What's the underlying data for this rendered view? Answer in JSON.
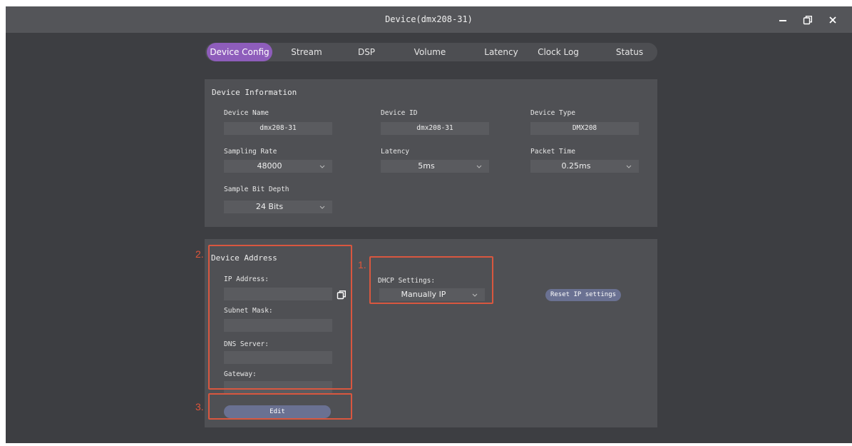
{
  "window": {
    "title": "Device(dmx208-31)",
    "controls": {
      "minimize_icon": "minimize-icon",
      "maximize_icon": "restore-icon",
      "close_icon": "close-icon"
    }
  },
  "tabs": [
    {
      "label": "Device Config",
      "active": true
    },
    {
      "label": "Stream",
      "active": false
    },
    {
      "label": "DSP",
      "active": false
    },
    {
      "label": "Volume",
      "active": false
    },
    {
      "label": "Latency",
      "active": false
    },
    {
      "label": "Clock Log",
      "active": false
    },
    {
      "label": "Status",
      "active": false
    }
  ],
  "device_info": {
    "title": "Device Information",
    "device_name": {
      "label": "Device Name",
      "value": "dmx208-31"
    },
    "device_id": {
      "label": "Device ID",
      "value": "dmx208-31"
    },
    "device_type": {
      "label": "Device Type",
      "value": "DMX208"
    },
    "sampling_rate": {
      "label": "Sampling Rate",
      "value": "48000"
    },
    "latency": {
      "label": "Latency",
      "value": "5ms"
    },
    "packet_time": {
      "label": "Packet Time",
      "value": "0.25ms"
    },
    "bit_depth": {
      "label": "Sample Bit Depth",
      "value": "24 Bits"
    }
  },
  "device_address": {
    "title": "Device Address",
    "ip_address": {
      "label": "IP Address:",
      "value": ""
    },
    "subnet_mask": {
      "label": "Subnet Mask:",
      "value": ""
    },
    "dns_server": {
      "label": "DNS Server:",
      "value": ""
    },
    "gateway": {
      "label": "Gateway:",
      "value": ""
    },
    "edit_label": "Edit",
    "dhcp": {
      "label": "DHCP Settings:",
      "value": "Manually IP"
    },
    "reset_label": "Reset IP settings"
  },
  "annotations": {
    "one": "1.",
    "two": "2.",
    "three": "3."
  },
  "colors": {
    "accent": "#8e5dbb",
    "highlight": "#d9573f",
    "button": "#6a7192"
  }
}
